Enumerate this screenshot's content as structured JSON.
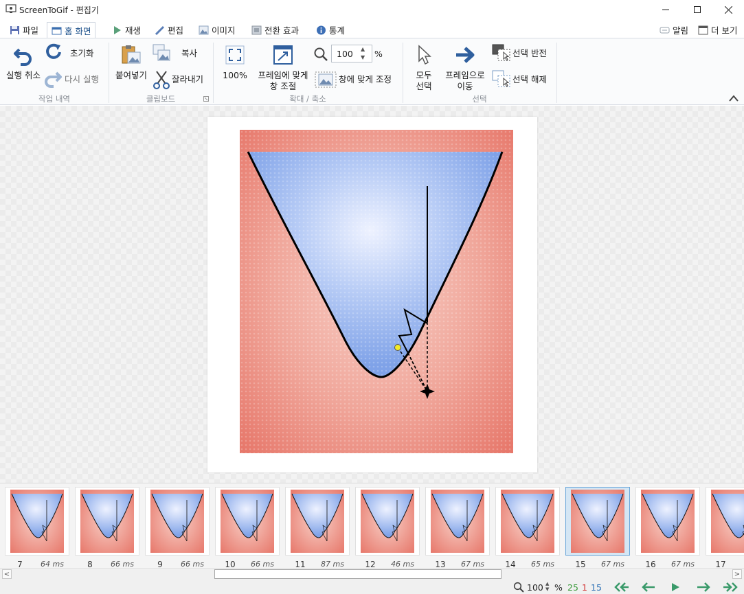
{
  "window": {
    "title": "ScreenToGif - 편집기"
  },
  "tabs": [
    {
      "label": "파일",
      "icon": "save-icon"
    },
    {
      "label": "홈 화면",
      "icon": "home-icon",
      "active": true
    },
    {
      "label": "재생",
      "icon": "play-icon"
    },
    {
      "label": "편집",
      "icon": "pencil-icon"
    },
    {
      "label": "이미지",
      "icon": "image-icon"
    },
    {
      "label": "전환 효과",
      "icon": "transition-icon"
    },
    {
      "label": "통계",
      "icon": "info-icon"
    }
  ],
  "top_right": {
    "notifications": "알림",
    "more_view": "더 보기"
  },
  "ribbon": {
    "history": {
      "group_label": "작업 내역",
      "undo": "실행 취소",
      "reset": "초기화",
      "redo": "다시 실행"
    },
    "clipboard": {
      "group_label": "클립보드",
      "paste": "붙여넣기",
      "copy": "복사",
      "cut": "잘라내기"
    },
    "zoom": {
      "group_label": "확대 / 축소",
      "zoom100": "100%",
      "fit_window_line1": "프레임에 맞게",
      "fit_window_line2": "창 조절",
      "zoom_value": "100",
      "zoom_unit": "%",
      "fit_image": "창에 맞게 조정"
    },
    "selection": {
      "group_label": "선택",
      "select_all_line1": "모두",
      "select_all_line2": "선택",
      "goto_line1": "프레임으로",
      "goto_line2": "이동",
      "invert": "선택 반전",
      "deselect": "선택 해제"
    }
  },
  "frames": [
    {
      "number": "7",
      "delay": "64 ms"
    },
    {
      "number": "8",
      "delay": "66 ms"
    },
    {
      "number": "9",
      "delay": "66 ms"
    },
    {
      "number": "10",
      "delay": "66 ms"
    },
    {
      "number": "11",
      "delay": "87 ms"
    },
    {
      "number": "12",
      "delay": "46 ms"
    },
    {
      "number": "13",
      "delay": "67 ms"
    },
    {
      "number": "14",
      "delay": "65 ms"
    },
    {
      "number": "15",
      "delay": "67 ms",
      "selected": true
    },
    {
      "number": "16",
      "delay": "67 ms"
    },
    {
      "number": "17",
      "delay": ""
    }
  ],
  "status": {
    "zoom_value": "100",
    "zoom_unit": "%",
    "frame_count": "25",
    "selected_count": "1",
    "current_frame": "15",
    "colors": {
      "count": "#3a9a3a",
      "selected": "#d23030",
      "current": "#2a6fb5",
      "nav": "#3a9a6a"
    }
  }
}
